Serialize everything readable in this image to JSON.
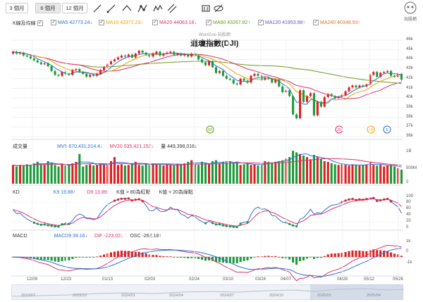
{
  "toolbar": {
    "ranges": [
      "3 個月",
      "6 個月",
      "12 個月"
    ],
    "active_range": "6 個月",
    "logo_text": "玩股網",
    "tools": [
      "line-tool-icon",
      "ray-tool-icon",
      "polyline-tool-icon",
      "fibonacci-icon",
      "wave-tool-icon",
      "channel-tool-icon",
      "eraser-icon",
      "hide-drawings-icon"
    ]
  },
  "kline_legend": {
    "label": "K線及均線",
    "items": [
      {
        "name": "MA5",
        "value": "42773.24",
        "arrow": "↓",
        "color": "#2a6fdb"
      },
      {
        "name": "MA10",
        "value": "43372.23",
        "arrow": "↓",
        "color": "#f0a000"
      },
      {
        "name": "MA20",
        "value": "44063.18",
        "arrow": "↓",
        "color": "#e0306a"
      },
      {
        "name": "MA60",
        "value": "43267.82",
        "arrow": "↑",
        "color": "#6a9c1a"
      },
      {
        "name": "MA120",
        "value": "41953.98",
        "arrow": "↑",
        "color": "#6a4fd0"
      },
      {
        "name": "MA240",
        "value": "40348.93",
        "arrow": "↑",
        "color": "#e07030"
      }
    ]
  },
  "chart_title": "道瓊指數(DJI)",
  "watermark": "WantGoo 玩股網",
  "volume_legend": {
    "label": "成交量",
    "mv5_name": "MV5",
    "mv5_value": "670,431,014.4",
    "mv5_arrow": "↓",
    "mv20_name": "MV20",
    "mv20_value": "535,421,152",
    "mv20_arrow": "↓",
    "vol_name": "量",
    "vol_value": "449,398,016",
    "vol_arrow": "↓"
  },
  "kd_legend": {
    "label": "KD",
    "k_name": "K9",
    "k_value": "19.88",
    "k_arrow": "↑",
    "d_name": "D9",
    "d_value": "13.89",
    "d_arrow": "↑",
    "red_dot_rule": "K值 > 80為紅點",
    "green_dot_rule": "K值 < 20為綠點"
  },
  "macd_legend": {
    "label": "MACD",
    "macd_name": "MACD9",
    "macd_value": "39.16",
    "macd_arrow": "↓",
    "dif_name": "DIF",
    "dif_value": "-223.02",
    "dif_arrow": "↓",
    "osc_name": "OSC",
    "osc_value": "-262.18",
    "osc_arrow": "↑"
  },
  "markers": [
    {
      "label": "60",
      "color": "#6a9c1a"
    },
    {
      "label": "20",
      "color": "#e0306a"
    },
    {
      "label": "10",
      "color": "#f0a000"
    },
    {
      "label": "5",
      "color": "#2a6fdb"
    }
  ],
  "price_axis": [
    "46k",
    "45k",
    "44k",
    "43k",
    "42k",
    "41k",
    "40k",
    "39k",
    "38k",
    "37k",
    "36k"
  ],
  "volume_axis": [
    "1B",
    "500M",
    "0"
  ],
  "kd_axis": [
    "100",
    "80",
    "60",
    "40",
    "20",
    "0"
  ],
  "macd_axis": [
    "1k",
    "0",
    "-1k"
  ],
  "date_axis": [
    "12/09",
    "12/23",
    "01/13",
    "02/03",
    "02/24",
    "03/10",
    "03/24",
    "04/07",
    "04/28",
    "05/12",
    "05/26"
  ],
  "navigator_axis": [
    "2023/07",
    "2023/10",
    "2024/01",
    "2024/04",
    "2024/07",
    "2024/10",
    "2025/01",
    "2025/04"
  ],
  "chart_data": {
    "type": "candlestick",
    "title": "道瓊指數(DJI)",
    "ylim": [
      36000,
      46000
    ],
    "close_series": [
      44800,
      44600,
      44700,
      44400,
      44300,
      44100,
      43900,
      43700,
      43500,
      43600,
      43300,
      42800,
      42400,
      42300,
      42700,
      42500,
      42400,
      42900,
      43000,
      42700,
      42500,
      42200,
      42400,
      42300,
      42500,
      42900,
      43200,
      43500,
      43800,
      44000,
      44200,
      44400,
      44300,
      44500,
      44200,
      44600,
      44900,
      44700,
      44500,
      44300,
      44600,
      44800,
      44400,
      44600,
      44700,
      44800,
      44500,
      44600,
      44400,
      44500,
      44300,
      44600,
      44400,
      44000,
      43700,
      43400,
      43800,
      43200,
      42600,
      42800,
      42300,
      42000,
      41900,
      41500,
      41400,
      42000,
      41800,
      41600,
      42300,
      42500,
      42300,
      41900,
      42100,
      42000,
      41600,
      41900,
      41200,
      40600,
      40800,
      40200,
      38300,
      37900,
      40800,
      39600,
      40200,
      40500,
      38200,
      39600,
      39100,
      40100,
      40400,
      40200,
      40000,
      40100,
      40300,
      40700,
      41100,
      41300,
      41100,
      41300,
      41200,
      41400,
      42400,
      42700,
      42200,
      42600,
      42700,
      42800,
      42300,
      42200,
      42500,
      41900
    ],
    "open_series": [
      44600,
      44800,
      44600,
      44700,
      44400,
      44300,
      44100,
      43900,
      43700,
      43500,
      43600,
      43300,
      42800,
      42400,
      42300,
      42700,
      42500,
      42400,
      42900,
      43000,
      42700,
      42500,
      42200,
      42400,
      42300,
      42500,
      42900,
      43200,
      43500,
      43800,
      44000,
      44200,
      44400,
      44300,
      44500,
      44200,
      44600,
      44900,
      44700,
      44500,
      44300,
      44600,
      44800,
      44400,
      44600,
      44700,
      44800,
      44500,
      44600,
      44400,
      44500,
      44300,
      44600,
      44400,
      44000,
      43700,
      43400,
      43800,
      43200,
      42600,
      42800,
      42300,
      42000,
      41900,
      41500,
      41400,
      42000,
      41800,
      41600,
      42300,
      42500,
      42300,
      41900,
      42100,
      42000,
      41600,
      41900,
      41200,
      40600,
      40800,
      40200,
      38300,
      37900,
      40800,
      39600,
      40200,
      40500,
      38200,
      39600,
      39100,
      40100,
      40400,
      40200,
      40000,
      40100,
      40300,
      40700,
      41100,
      41300,
      41100,
      41300,
      41200,
      41400,
      42400,
      42700,
      42200,
      42600,
      42700,
      42800,
      42300,
      42200,
      42500
    ],
    "volume_series": [
      0.6,
      0.55,
      0.6,
      0.58,
      0.62,
      0.6,
      0.65,
      0.7,
      0.62,
      0.6,
      0.72,
      0.68,
      0.6,
      0.55,
      0.62,
      0.58,
      0.6,
      0.65,
      0.7,
      0.95,
      0.55,
      0.6,
      0.62,
      0.58,
      0.6,
      0.65,
      0.62,
      0.6,
      0.72,
      0.85,
      0.6,
      0.62,
      0.58,
      0.6,
      0.65,
      0.7,
      0.6,
      0.58,
      0.62,
      0.6,
      0.65,
      0.62,
      0.6,
      0.58,
      0.62,
      0.6,
      0.58,
      0.62,
      0.6,
      0.65,
      0.7,
      0.75,
      0.62,
      0.6,
      0.7,
      0.65,
      0.62,
      0.72,
      0.75,
      0.65,
      0.7,
      0.68,
      0.72,
      0.65,
      0.7,
      0.6,
      0.62,
      0.65,
      0.6,
      0.62,
      0.58,
      0.6,
      0.72,
      0.7,
      0.68,
      0.7,
      0.72,
      0.75,
      0.8,
      0.85,
      1.05,
      1.0,
      0.95,
      0.9,
      0.85,
      0.78,
      0.92,
      0.85,
      0.8,
      0.72,
      0.7,
      0.65,
      0.62,
      0.6,
      0.62,
      0.6,
      0.58,
      0.62,
      0.6,
      0.58,
      0.6,
      0.62,
      0.7,
      0.6,
      0.58,
      0.6,
      0.55,
      0.58,
      0.6,
      0.55,
      0.5,
      0.45
    ]
  }
}
